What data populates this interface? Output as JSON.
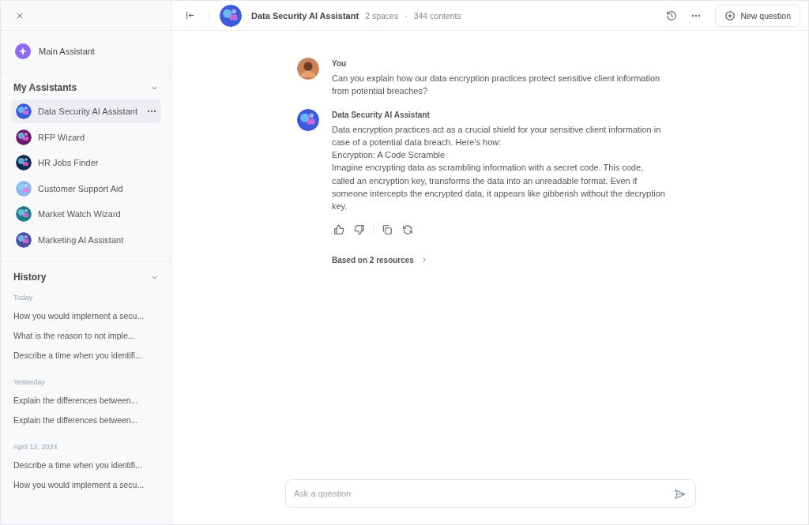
{
  "sidebar": {
    "main_assistant": "Main Assistant",
    "assistants_heading": "My Assistants",
    "assistants": [
      {
        "name": "Data Security AI Assistant",
        "selected": true,
        "color": "#3b5bdb"
      },
      {
        "name": "RFP Wizard",
        "selected": false,
        "color": "#6a1b6e"
      },
      {
        "name": "HR Jobs Finder",
        "selected": false,
        "color": "#0d2a55"
      },
      {
        "name": "Customer Support Aid",
        "selected": false,
        "color": "#8fb4f0"
      },
      {
        "name": "Market Watch Wizard",
        "selected": false,
        "color": "#1f7a8c"
      },
      {
        "name": "Marketing AI Assistant",
        "selected": false,
        "color": "#4a4fa8"
      }
    ],
    "history_heading": "History",
    "history": [
      {
        "date": "Today",
        "items": [
          "How you would implement a secu...",
          "What is the reason to not imple...",
          "Describe a time when you identifi..."
        ]
      },
      {
        "date": "Yesterday",
        "items": [
          "Explain the differences between...",
          "Explain the differences between..."
        ]
      },
      {
        "date": "April 12, 2024",
        "items": [
          "Describe a time when you identifi...",
          "How you would implement a secu..."
        ]
      }
    ]
  },
  "header": {
    "title": "Data Security AI Assistant",
    "spaces": "2 spaces",
    "separator": "·",
    "contents": "344 contents",
    "new_question": "New question"
  },
  "messages": [
    {
      "kind": "user",
      "author": "You",
      "paragraphs": [
        "Can you explain how our data encryption practices protect sensitive client information from potential breaches?"
      ]
    },
    {
      "kind": "assistant",
      "author": "Data Security AI Assistant",
      "paragraphs": [
        "Data encryption practices act as a crucial shield for your sensitive client information in case of a potential data breach. Here's how:",
        "Encryption: A Code Scramble",
        "Imagine encrypting data as scrambling information with a secret code.  This code, called an encryption key, transforms the data into an unreadable format. Even if someone intercepts the encrypted data, it appears like gibberish without the decryption key."
      ],
      "resources": "Based on 2 resources"
    }
  ],
  "composer": {
    "placeholder": "Ask a question"
  }
}
